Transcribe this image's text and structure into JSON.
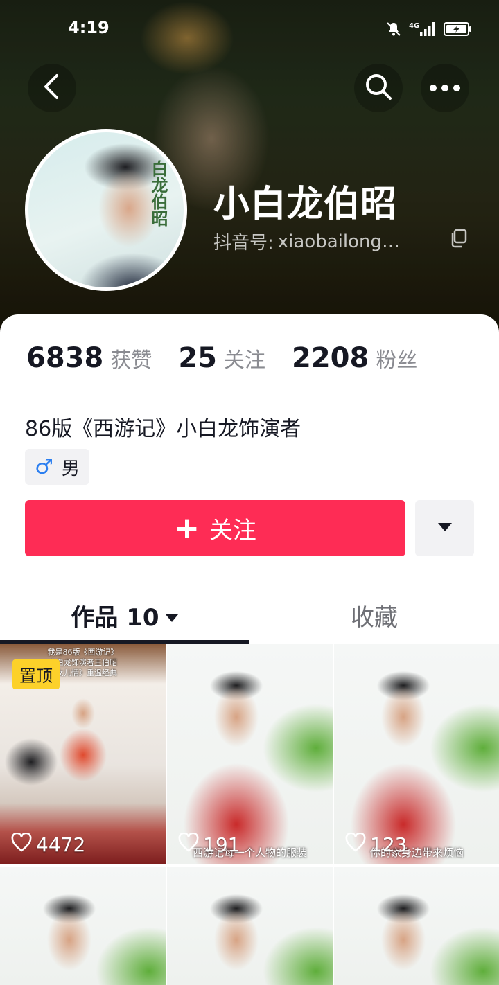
{
  "status_bar": {
    "time": "4:19",
    "network": "4G",
    "icons": [
      "bell-muted-icon",
      "signal-icon",
      "battery-charging-icon"
    ]
  },
  "header": {
    "icons": [
      "back-arrow-icon",
      "search-icon",
      "more-dots-icon"
    ]
  },
  "profile": {
    "nickname": "小白龙伯昭",
    "douyin_id_label": "抖音号:",
    "douyin_id_value": "xiaobailong…",
    "avatar_calligraphy": "白龙伯昭"
  },
  "stats": [
    {
      "value": "6838",
      "label": "获赞"
    },
    {
      "value": "25",
      "label": "关注"
    },
    {
      "value": "2208",
      "label": "粉丝"
    }
  ],
  "bio": "86版《西游记》小白龙饰演者",
  "gender": {
    "symbol": "♂",
    "label": "男"
  },
  "actions": {
    "follow_plus": "+",
    "follow_label": "关注"
  },
  "tabs": {
    "works_label": "作品 10",
    "favorites_label": "收藏"
  },
  "videos": [
    {
      "pinned_label": "置顶",
      "caption": "我是86版《西游记》\n小白龙饰演者王伯昭\n《女儿情》重温经典",
      "likes": "4472",
      "subtitle": ""
    },
    {
      "pinned_label": "",
      "caption": "",
      "likes": "191",
      "subtitle": "西游记每一个人物的服装"
    },
    {
      "pinned_label": "",
      "caption": "",
      "likes": "123",
      "subtitle": "你的家身边带来烦恼"
    },
    {
      "pinned_label": "",
      "caption": "",
      "likes": "",
      "subtitle": ""
    },
    {
      "pinned_label": "",
      "caption": "",
      "likes": "",
      "subtitle": ""
    },
    {
      "pinned_label": "",
      "caption": "",
      "likes": "",
      "subtitle": ""
    }
  ],
  "colors": {
    "accent": "#fe2c55",
    "pin_badge": "#fcd12a",
    "text_primary": "#161823",
    "text_secondary": "#8a8b91",
    "gender_blue": "#2c7ff0"
  }
}
